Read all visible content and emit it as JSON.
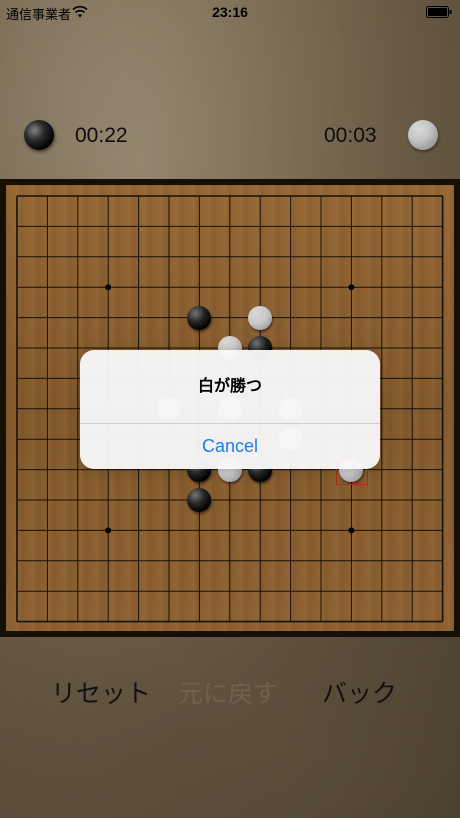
{
  "status_bar": {
    "carrier": "通信事業者",
    "time": "23:16"
  },
  "players": {
    "black": {
      "icon": "black-stone-icon",
      "timer": "00:22"
    },
    "white": {
      "icon": "white-stone-icon",
      "timer": "00:03"
    }
  },
  "board": {
    "grid_size": 15,
    "star_points": [
      [
        3,
        3
      ],
      [
        11,
        3
      ],
      [
        3,
        11
      ],
      [
        11,
        11
      ]
    ],
    "stones": [
      {
        "color": "black",
        "col": 6,
        "row": 4
      },
      {
        "color": "white",
        "col": 8,
        "row": 4
      },
      {
        "color": "white",
        "col": 7,
        "row": 5
      },
      {
        "color": "black",
        "col": 8,
        "row": 5
      },
      {
        "color": "white",
        "col": 5,
        "row": 7
      },
      {
        "color": "white",
        "col": 7,
        "row": 7
      },
      {
        "color": "white",
        "col": 9,
        "row": 7
      },
      {
        "color": "white",
        "col": 9,
        "row": 8
      },
      {
        "color": "black",
        "col": 6,
        "row": 9
      },
      {
        "color": "white",
        "col": 7,
        "row": 9
      },
      {
        "color": "black",
        "col": 8,
        "row": 9
      },
      {
        "color": "white",
        "col": 11,
        "row": 9
      },
      {
        "color": "black",
        "col": 6,
        "row": 10
      }
    ],
    "last_move": {
      "col": 11,
      "row": 9
    }
  },
  "alert": {
    "title": "白が勝つ",
    "button": "Cancel"
  },
  "controls": {
    "reset": "リセット",
    "undo": "元に戻す",
    "back": "バック"
  },
  "colors": {
    "alert_button": "#1a7ff0",
    "board": "#a8743b",
    "last_move_marker": "#c4371f"
  }
}
